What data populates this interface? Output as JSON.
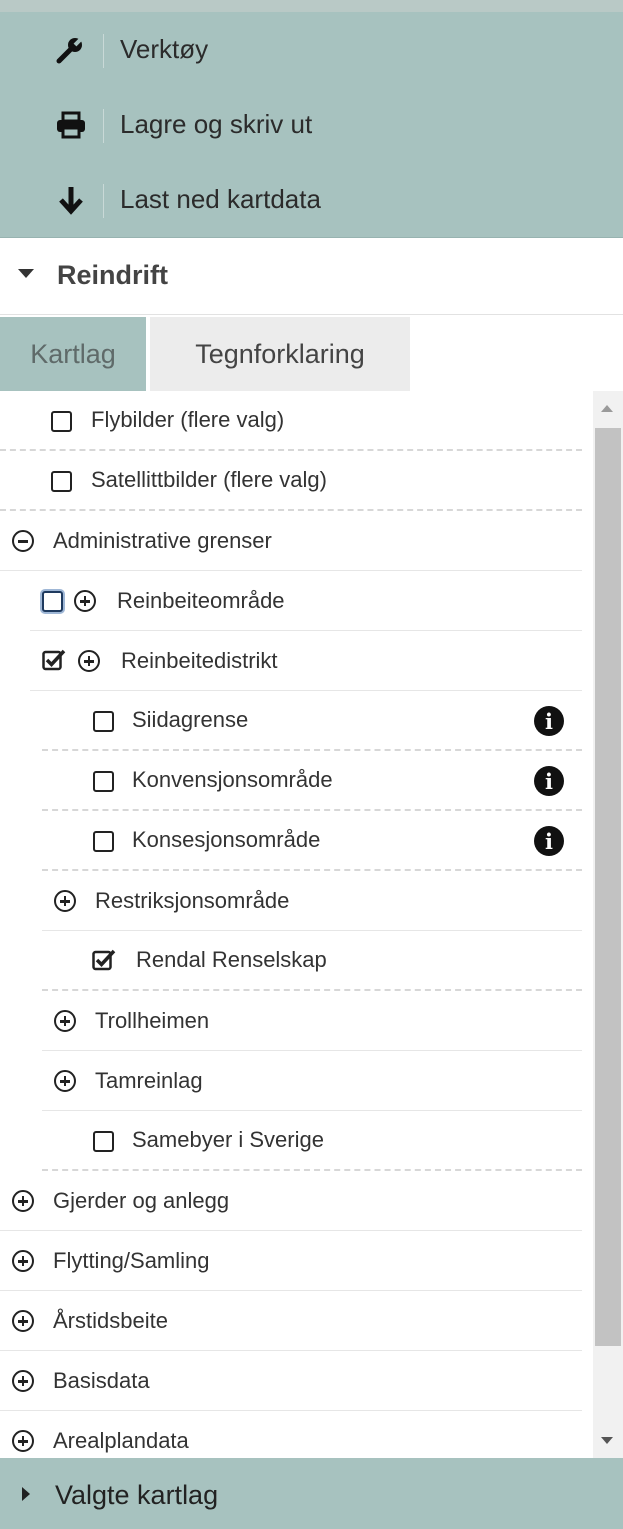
{
  "toolbar": {
    "items": [
      {
        "label": "Verktøy",
        "icon": "wrench-icon"
      },
      {
        "label": "Lagre og skriv ut",
        "icon": "printer-icon"
      },
      {
        "label": "Last ned kartdata",
        "icon": "arrow-down-icon"
      }
    ]
  },
  "section": {
    "title": "Reindrift"
  },
  "tabs": {
    "kartlag": "Kartlag",
    "tegnforklaring": "Tegnforklaring",
    "active": "Kartlag"
  },
  "layers": {
    "flybilder": "Flybilder (flere valg)",
    "satellittbilder": "Satellittbilder (flere valg)",
    "administrative": "Administrative grenser",
    "reinbeiteomrade": "Reinbeiteområde",
    "reinbeitedistrikt": "Reinbeitedistrikt",
    "siidagrense": "Siidagrense",
    "konvensjonsomrade": "Konvensjonsområde",
    "konsesjonsomrade": "Konsesjonsområde",
    "restriksjonsomrade": "Restriksjonsområde",
    "rendal": "Rendal Renselskap",
    "trollheimen": "Trollheimen",
    "tamreinlag": "Tamreinlag",
    "samebyer": "Samebyer i Sverige",
    "gjerder": "Gjerder og anlegg",
    "flytting": "Flytting/Samling",
    "arstidsbeite": "Årstidsbeite",
    "basisdata": "Basisdata",
    "arealplandata": "Arealplandata"
  },
  "info_glyph": "i",
  "footer": {
    "title": "Valgte kartlag"
  },
  "colors": {
    "toolbar_bg": "#a7c2bf",
    "active_tab_bg": "#a7c2bf",
    "inactive_tab_bg": "#ececec"
  }
}
